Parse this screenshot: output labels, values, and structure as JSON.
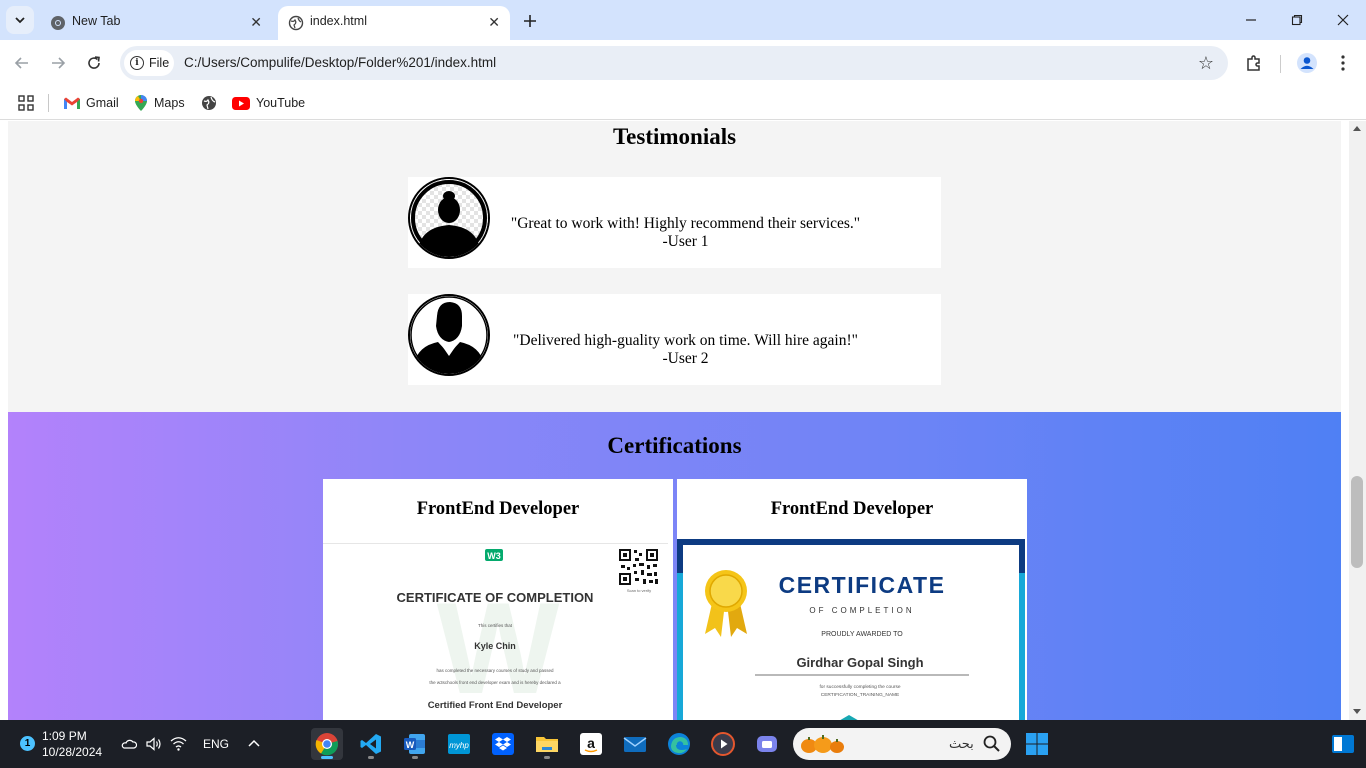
{
  "browser": {
    "tabs": [
      {
        "title": "New Tab",
        "active": false
      },
      {
        "title": "index.html",
        "active": true
      }
    ],
    "address": {
      "chip_label": "File",
      "url": "C:/Users/Compulife/Desktop/Folder%201/index.html"
    },
    "bookmarks": [
      {
        "label": "Gmail",
        "icon": "gmail-icon"
      },
      {
        "label": "Maps",
        "icon": "maps-icon"
      },
      {
        "label": "",
        "icon": "globe-icon"
      },
      {
        "label": "YouTube",
        "icon": "youtube-icon"
      }
    ]
  },
  "page": {
    "testimonials": {
      "title": "Testimonials",
      "items": [
        {
          "quote": "\"Great to work with! Highly recommend their services.\"",
          "author": "-User 1",
          "avatar": "female-avatar-icon"
        },
        {
          "quote": "\"Delivered high-guality work on time. Will hire again!\"",
          "author": "-User 2",
          "avatar": "male-avatar-icon"
        }
      ]
    },
    "certifications": {
      "title": "Certifications",
      "cards": [
        {
          "title": "FrontEnd Developer",
          "certificate": {
            "heading": "CERTIFICATE OF COMPLETION",
            "line1": "This certifies that",
            "name": "Kyle Chin",
            "line2": "has completed the necessary courses of study and passed",
            "line3": "the w3schools front end developer exam and is hereby declared a",
            "award": "Certified Front End Developer",
            "qr_caption": "Scan to verify"
          }
        },
        {
          "title": "FrontEnd Developer",
          "certificate": {
            "heading": "CERTIFICATE",
            "sub": "OF COMPLETION",
            "awarded": "PROUDLY AWARDED TO",
            "name": "Girdhar Gopal Singh",
            "line1": "for successfully completing the course",
            "line2": "CERTIFICATION_TRAINING_NAME"
          }
        }
      ]
    }
  },
  "taskbar": {
    "notification_count": "1",
    "time": "1:09 PM",
    "date": "10/28/2024",
    "language": "ENG",
    "search_text": "بحث"
  },
  "colors": {
    "titlebar": "#d3e3fd",
    "cert_gradient_start": "#b382fb",
    "cert_gradient_end": "#4f80f4",
    "taskbar": "#1c1f26"
  }
}
